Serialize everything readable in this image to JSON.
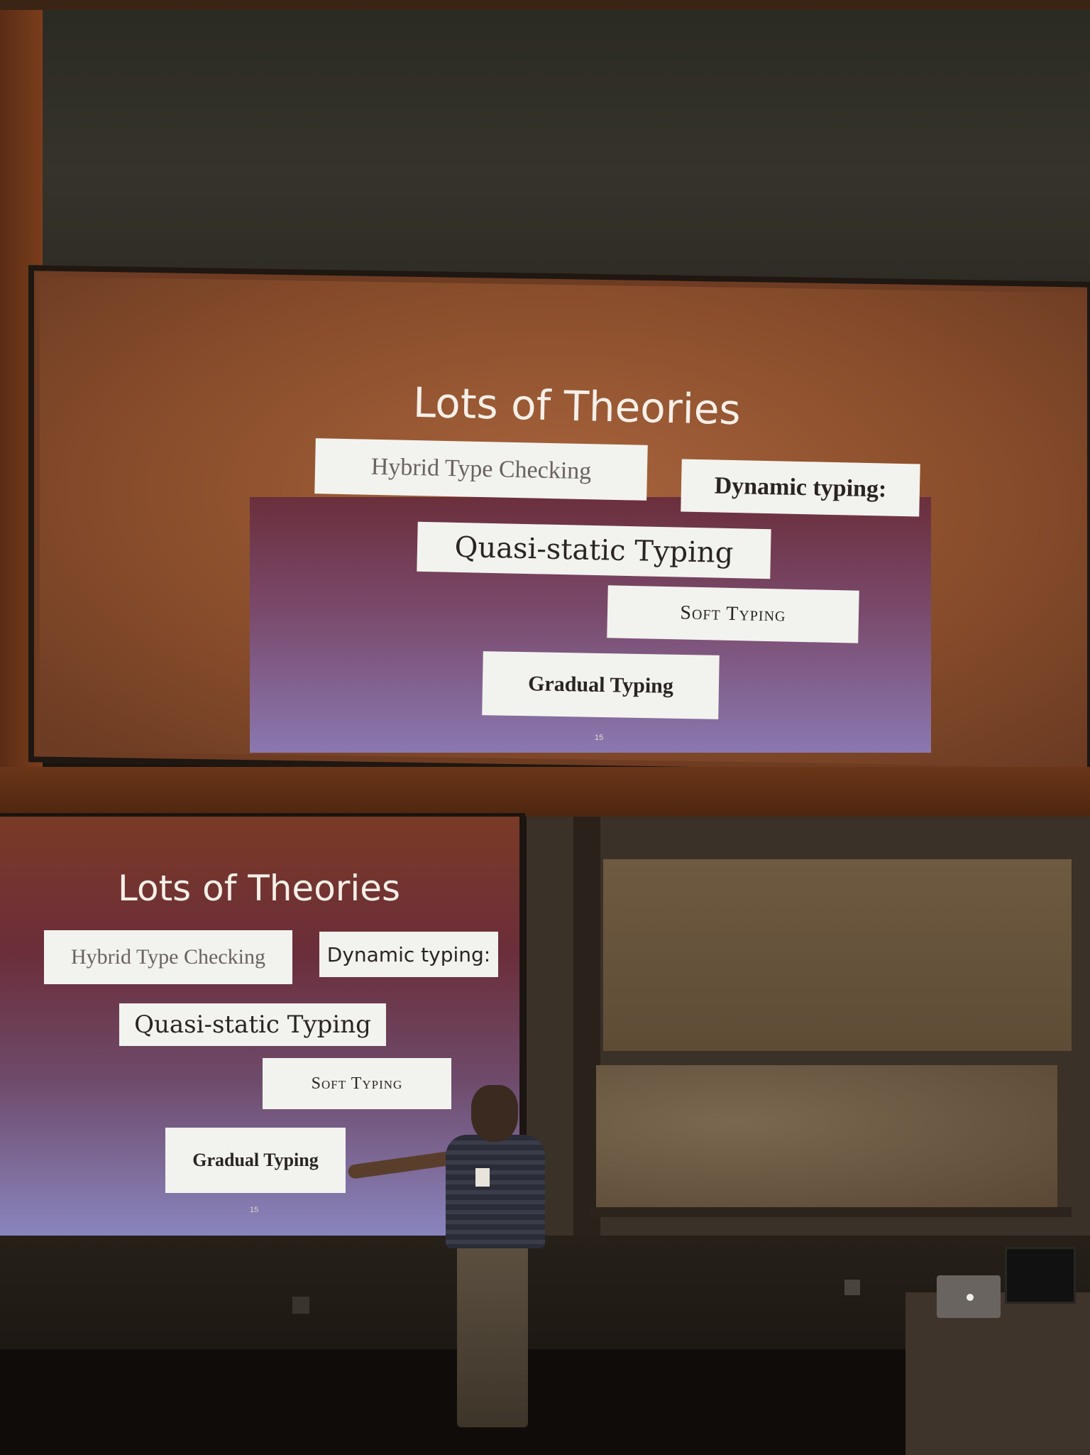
{
  "top_slide": {
    "title": "Lots of Theories",
    "boxes": {
      "hybrid": "Hybrid Type Checking",
      "dynamic": "Dynamic typing:",
      "quasi": "Quasi-static Typing",
      "soft": "Soft Typing",
      "gradual": "Gradual Typing"
    },
    "page_number": "15"
  },
  "bottom_slide": {
    "title": "Lots of Theories",
    "boxes": {
      "hybrid": "Hybrid Type Checking",
      "dynamic": "Dynamic typing:",
      "quasi": "Quasi-static Typing",
      "soft": "Soft Typing",
      "gradual": "Gradual Typing"
    },
    "page_number": "15"
  },
  "colors": {
    "slide_gradient_top": "#6b2f3c",
    "slide_gradient_bottom": "#8a86c0",
    "box_fill": "#f2f3ee",
    "wall_wood": "#7a3d1c"
  }
}
